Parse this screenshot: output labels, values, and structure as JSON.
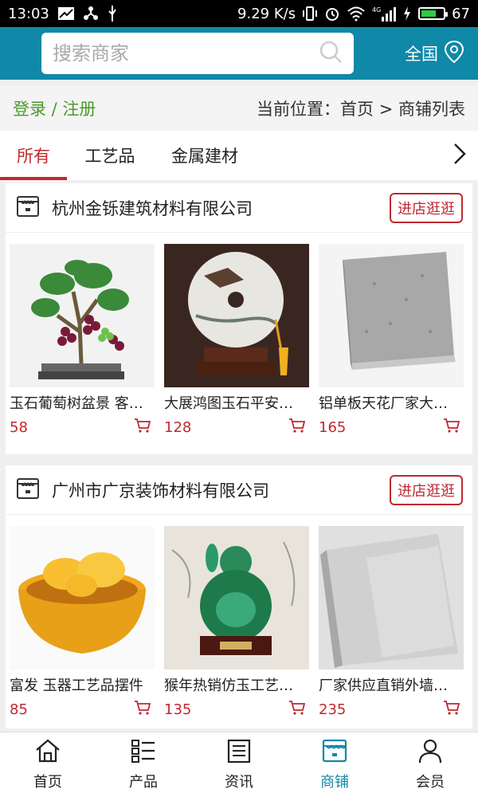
{
  "status": {
    "time": "13:03",
    "speed": "9.29 K/s",
    "battery": "67",
    "battery_level": 0.67,
    "network": "4G"
  },
  "header": {
    "search_placeholder": "搜索商家",
    "region_label": "全国"
  },
  "crumbbar": {
    "login": "登录 / 注册",
    "location": "当前位置：首页 > 商铺列表"
  },
  "tabs": [
    {
      "label": "所有",
      "active": true
    },
    {
      "label": "工艺品",
      "active": false
    },
    {
      "label": "金属建材",
      "active": false
    }
  ],
  "stores": [
    {
      "name": "杭州金铄建筑材料有限公司",
      "enter_label": "进店逛逛",
      "products": [
        {
          "name": "玉石葡萄树盆景 客厅摆件",
          "price": "58",
          "image": "jade-grape-tree"
        },
        {
          "name": "大展鸿图玉石平安扣摆件",
          "price": "128",
          "image": "jade-disc-eagle"
        },
        {
          "name": "铝单板天花厂家大量供应",
          "price": "165",
          "image": "granite-aluminum-panel"
        }
      ]
    },
    {
      "name": "广州市广京装饰材料有限公司",
      "enter_label": "进店逛逛",
      "products": [
        {
          "name": "富发 玉器工艺品摆件",
          "price": "85",
          "image": "yellow-jade-bowl"
        },
        {
          "name": "猴年热销仿玉工艺品摆件",
          "price": "135",
          "image": "green-buddha"
        },
        {
          "name": "厂家供应直销外墙铝单板",
          "price": "235",
          "image": "white-aluminum-panel"
        }
      ]
    }
  ],
  "bottomnav": [
    {
      "label": "首页",
      "icon": "home-icon",
      "active": false
    },
    {
      "label": "产品",
      "icon": "grid-list-icon",
      "active": false
    },
    {
      "label": "资讯",
      "icon": "news-icon",
      "active": false
    },
    {
      "label": "商铺",
      "icon": "store-icon",
      "active": true
    },
    {
      "label": "会员",
      "icon": "user-icon",
      "active": false
    }
  ],
  "colors": {
    "header": "#1088a8",
    "accent_red": "#c0282f",
    "login_green": "#4a9a2a"
  }
}
